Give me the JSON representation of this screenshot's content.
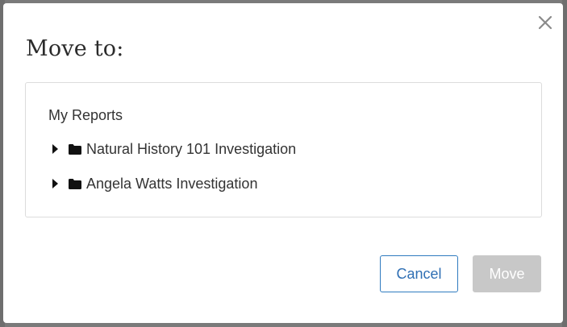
{
  "dialog": {
    "title": "Move to:",
    "close_icon": "close-icon",
    "tree": {
      "root_label": "My Reports",
      "items": [
        {
          "label": "Natural History 101 Investigation",
          "expand_icon": "caret-right-icon",
          "icon": "folder-icon"
        },
        {
          "label": "Angela Watts Investigation",
          "expand_icon": "caret-right-icon",
          "icon": "folder-icon"
        }
      ]
    },
    "buttons": {
      "cancel_label": "Cancel",
      "move_label": "Move",
      "move_enabled": false
    }
  },
  "colors": {
    "overlay": "#7a7a7a",
    "dialog_bg": "#ffffff",
    "cancel_text": "#2f6fb4",
    "cancel_border": "#2f7bbf",
    "move_disabled_bg": "#c8c8c8"
  }
}
